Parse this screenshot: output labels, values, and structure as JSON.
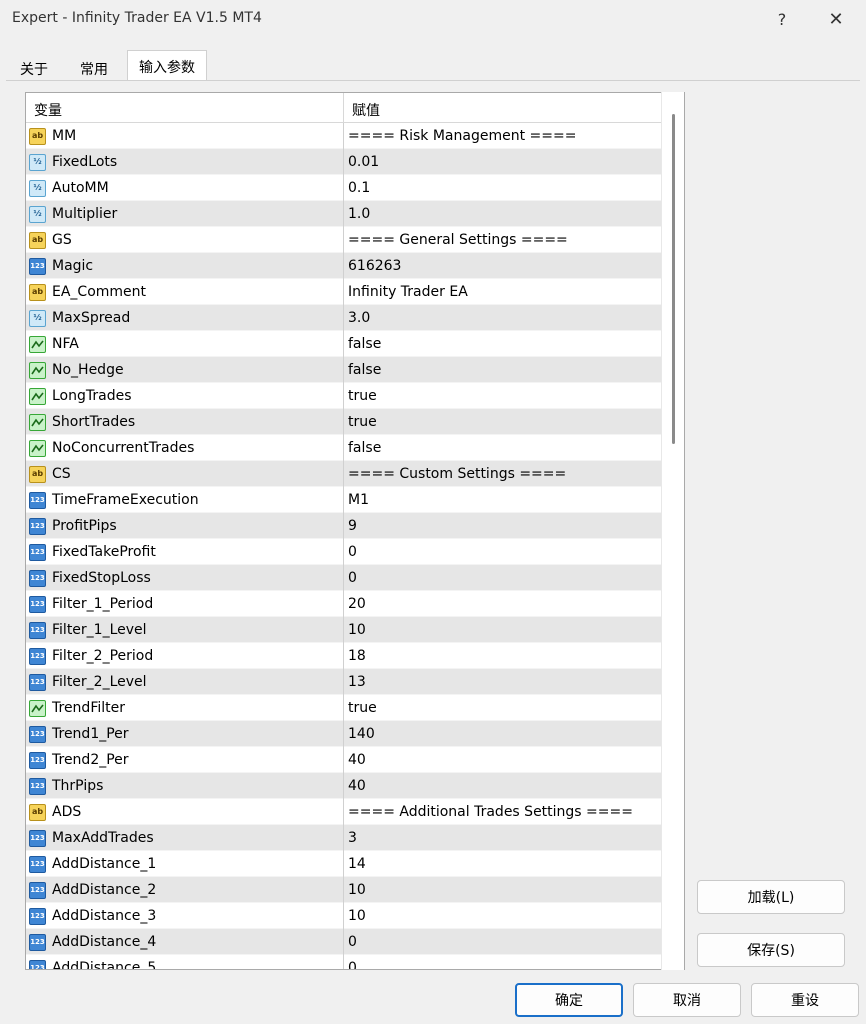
{
  "window": {
    "title": "Expert - Infinity Trader EA V1.5 MT4",
    "help": "?",
    "close": "✕"
  },
  "tabs": [
    {
      "label": "关于",
      "active": false
    },
    {
      "label": "常用",
      "active": false
    },
    {
      "label": "输入参数",
      "active": true
    }
  ],
  "grid": {
    "col_variable": "变量",
    "col_value": "赋值",
    "rows": [
      {
        "type": "string",
        "name": "MM",
        "value": "==== Risk Management ===="
      },
      {
        "type": "double",
        "name": "FixedLots",
        "value": "0.01"
      },
      {
        "type": "double",
        "name": "AutoMM",
        "value": "0.1"
      },
      {
        "type": "double",
        "name": "Multiplier",
        "value": "1.0"
      },
      {
        "type": "string",
        "name": "GS",
        "value": "==== General Settings ===="
      },
      {
        "type": "int",
        "name": "Magic",
        "value": "616263"
      },
      {
        "type": "string",
        "name": "EA_Comment",
        "value": "Infinity Trader EA"
      },
      {
        "type": "double",
        "name": "MaxSpread",
        "value": "3.0"
      },
      {
        "type": "bool",
        "name": "NFA",
        "value": "false"
      },
      {
        "type": "bool",
        "name": "No_Hedge",
        "value": "false"
      },
      {
        "type": "bool",
        "name": "LongTrades",
        "value": "true"
      },
      {
        "type": "bool",
        "name": "ShortTrades",
        "value": "true"
      },
      {
        "type": "bool",
        "name": "NoConcurrentTrades",
        "value": "false"
      },
      {
        "type": "string",
        "name": "CS",
        "value": "==== Custom Settings ===="
      },
      {
        "type": "int",
        "name": "TimeFrameExecution",
        "value": "M1"
      },
      {
        "type": "int",
        "name": "ProfitPips",
        "value": "9"
      },
      {
        "type": "int",
        "name": "FixedTakeProfit",
        "value": "0"
      },
      {
        "type": "int",
        "name": "FixedStopLoss",
        "value": "0"
      },
      {
        "type": "int",
        "name": "Filter_1_Period",
        "value": "20"
      },
      {
        "type": "int",
        "name": "Filter_1_Level",
        "value": "10"
      },
      {
        "type": "int",
        "name": "Filter_2_Period",
        "value": "18"
      },
      {
        "type": "int",
        "name": "Filter_2_Level",
        "value": "13"
      },
      {
        "type": "bool",
        "name": "TrendFilter",
        "value": "true"
      },
      {
        "type": "int",
        "name": "Trend1_Per",
        "value": "140"
      },
      {
        "type": "int",
        "name": "Trend2_Per",
        "value": "40"
      },
      {
        "type": "int",
        "name": "ThrPips",
        "value": "40"
      },
      {
        "type": "string",
        "name": "ADS",
        "value": "==== Additional Trades Settings ===="
      },
      {
        "type": "int",
        "name": "MaxAddTrades",
        "value": "3"
      },
      {
        "type": "int",
        "name": "AddDistance_1",
        "value": "14"
      },
      {
        "type": "int",
        "name": "AddDistance_2",
        "value": "10"
      },
      {
        "type": "int",
        "name": "AddDistance_3",
        "value": "10"
      },
      {
        "type": "int",
        "name": "AddDistance_4",
        "value": "0"
      },
      {
        "type": "int",
        "name": "AddDistance_5",
        "value": "0"
      }
    ]
  },
  "icons": {
    "string": "ab",
    "double": "½",
    "int": "123",
    "bool": "bool-icon"
  },
  "buttons": {
    "load": "加载(L)",
    "save": "保存(S)",
    "ok": "确定",
    "cancel": "取消",
    "reset": "重设"
  },
  "colors": {
    "accent": "#1a6fc9",
    "row_alt": "#e6e6e6"
  }
}
